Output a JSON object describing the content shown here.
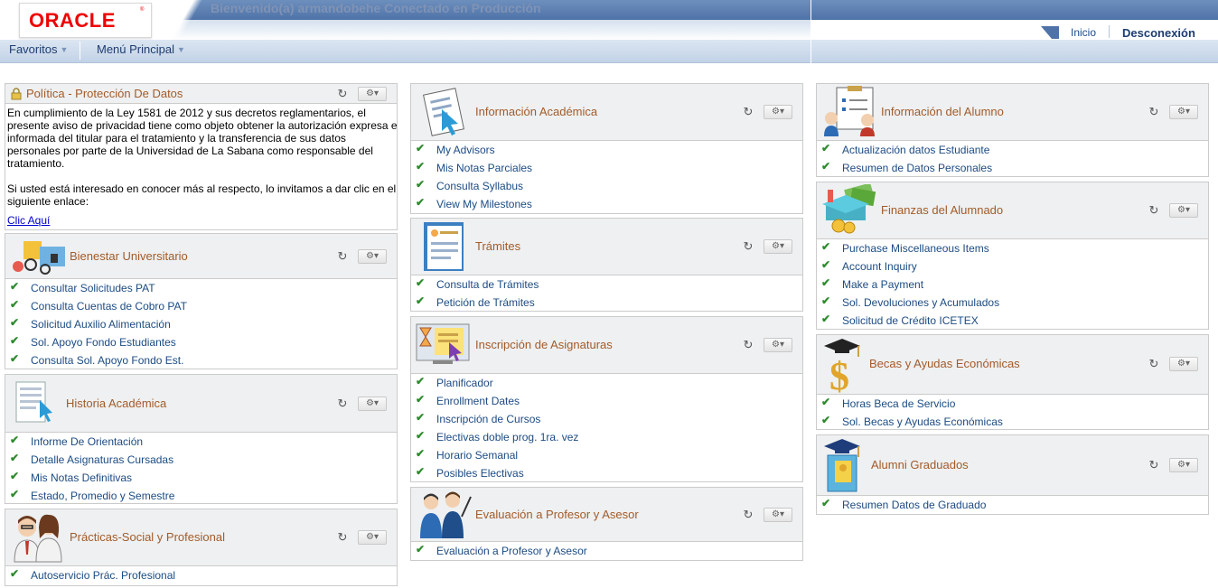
{
  "header": {
    "logo_text": "ORACLE",
    "welcome": "Bienvenido(a) armandobehe Conectado en Producción",
    "nav_home": "Inicio",
    "nav_logout": "Desconexión"
  },
  "menubar": {
    "favorites": "Favoritos",
    "main_menu": "Menú Principal"
  },
  "colors": {
    "link": "#1c4b82",
    "title": "#a35b2a",
    "check": "#2e8b2e",
    "header_band": "#4f73a8",
    "pagelet_header": "#eef0f1"
  },
  "col1": {
    "policy": {
      "title": "Política - Protección De Datos",
      "para1": "En cumplimiento de la Ley 1581 de 2012 y sus decretos reglamentarios, el presente aviso de privacidad tiene como objeto obtener la autorización expresa e informada del titular para el tratamiento y la transferencia de sus datos personales por parte de la Universidad de La Sabana como responsable del tratamiento.",
      "para2": "Si usted está interesado en conocer más al respecto, lo invitamos a dar clic en el siguiente enlace:",
      "link": "Clic Aquí"
    },
    "bienestar": {
      "title": "Bienestar Universitario",
      "items": [
        "Consultar Solicitudes PAT",
        "Consulta Cuentas de Cobro PAT",
        "Solicitud Auxilio Alimentación",
        "Sol. Apoyo Fondo Estudiantes",
        "Consulta Sol. Apoyo Fondo Est."
      ]
    },
    "historia": {
      "title": "Historia Académica",
      "items": [
        "Informe De Orientación",
        "Detalle Asignaturas Cursadas",
        "Mis Notas Definitivas",
        "Estado, Promedio y Semestre"
      ]
    },
    "practicas": {
      "title": "Prácticas-Social y Profesional",
      "items": [
        "Autoservicio Prác. Profesional"
      ]
    }
  },
  "col2": {
    "info_academica": {
      "title": "Información Académica",
      "items": [
        "My Advisors",
        "Mis Notas Parciales",
        "Consulta Syllabus",
        "View My Milestones"
      ]
    },
    "tramites": {
      "title": "Trámites",
      "items": [
        "Consulta de Trámites",
        "Petición de Trámites"
      ]
    },
    "inscripcion": {
      "title": "Inscripción de Asignaturas",
      "items": [
        "Planificador",
        "Enrollment Dates",
        "Inscripción de Cursos",
        "Electivas doble prog. 1ra. vez",
        "Horario Semanal",
        "Posibles Electivas"
      ]
    },
    "evaluacion": {
      "title": "Evaluación a Profesor y Asesor",
      "items": [
        "Evaluación a Profesor y Asesor"
      ]
    }
  },
  "col3": {
    "info_alumno": {
      "title": "Información del Alumno",
      "items": [
        "Actualización datos Estudiante",
        "Resumen de Datos Personales"
      ]
    },
    "finanzas": {
      "title": "Finanzas del Alumnado",
      "items": [
        "Purchase Miscellaneous Items",
        "Account Inquiry",
        "Make a Payment",
        "Sol. Devoluciones y Acumulados",
        "Solicitud de Crédito ICETEX"
      ]
    },
    "becas": {
      "title": "Becas y Ayudas Económicas",
      "items": [
        "Horas Beca de Servicio",
        "Sol. Becas y Ayudas Económicas"
      ]
    },
    "alumni": {
      "title": "Alumni Graduados",
      "items": [
        "Resumen Datos de Graduado"
      ]
    }
  }
}
